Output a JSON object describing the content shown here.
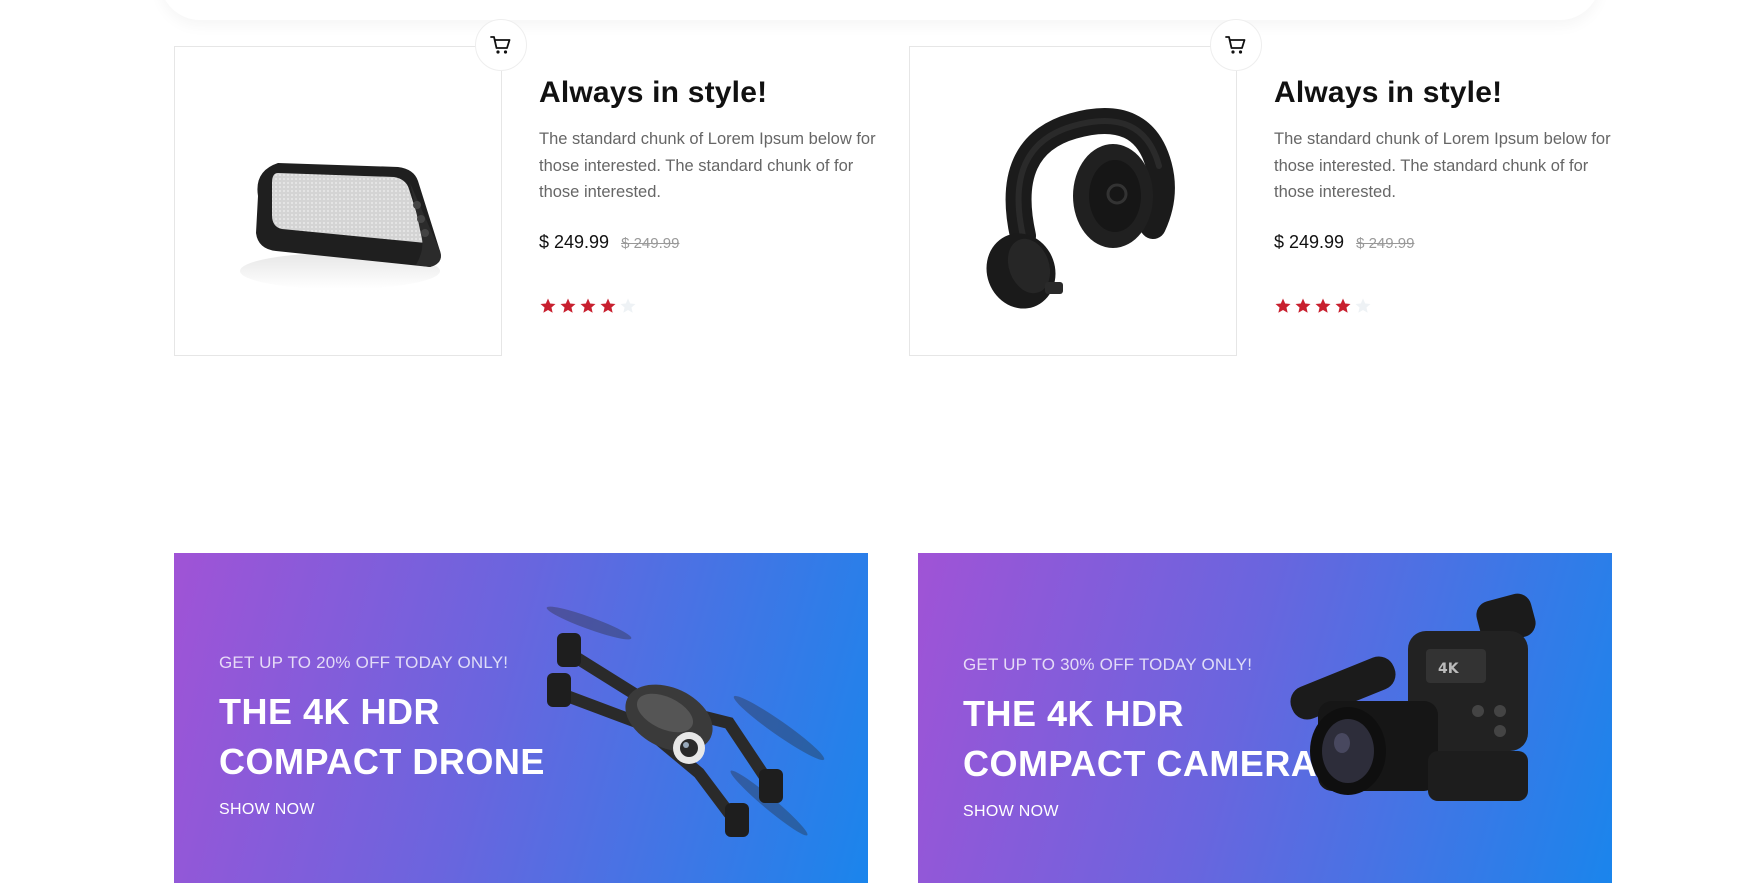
{
  "products": [
    {
      "title": "Always in style!",
      "description": "The standard chunk of Lorem Ipsum below for those interested. The standard chunk of for those interested.",
      "price": "$ 249.99",
      "old_price": "$ 249.99",
      "rating": 4,
      "max_rating": 5,
      "image": "portable-speaker",
      "cart_icon": "cart-icon"
    },
    {
      "title": "Always in style!",
      "description": "The standard chunk of Lorem Ipsum below for those interested. The standard chunk of for those interested.",
      "price": "$ 249.99",
      "old_price": "$ 249.99",
      "rating": 4,
      "max_rating": 5,
      "image": "headphones",
      "cart_icon": "cart-icon"
    }
  ],
  "banners": [
    {
      "offer": "GET UP TO 20% OFF TODAY ONLY!",
      "headline_line1": "THE 4K HDR",
      "headline_line2": "COMPACT DRONE",
      "cta": "SHOW NOW",
      "image": "drone"
    },
    {
      "offer": "GET UP TO 30% OFF TODAY ONLY!",
      "headline_line1": "THE 4K HDR",
      "headline_line2": "COMPACT CAMERA",
      "cta": "SHOW NOW",
      "image": "video-camera"
    }
  ],
  "colors": {
    "star_filled": "#c8202f",
    "star_empty": "#eef2f5",
    "gradient_start": "#a053d6",
    "gradient_end": "#1a85ec"
  }
}
